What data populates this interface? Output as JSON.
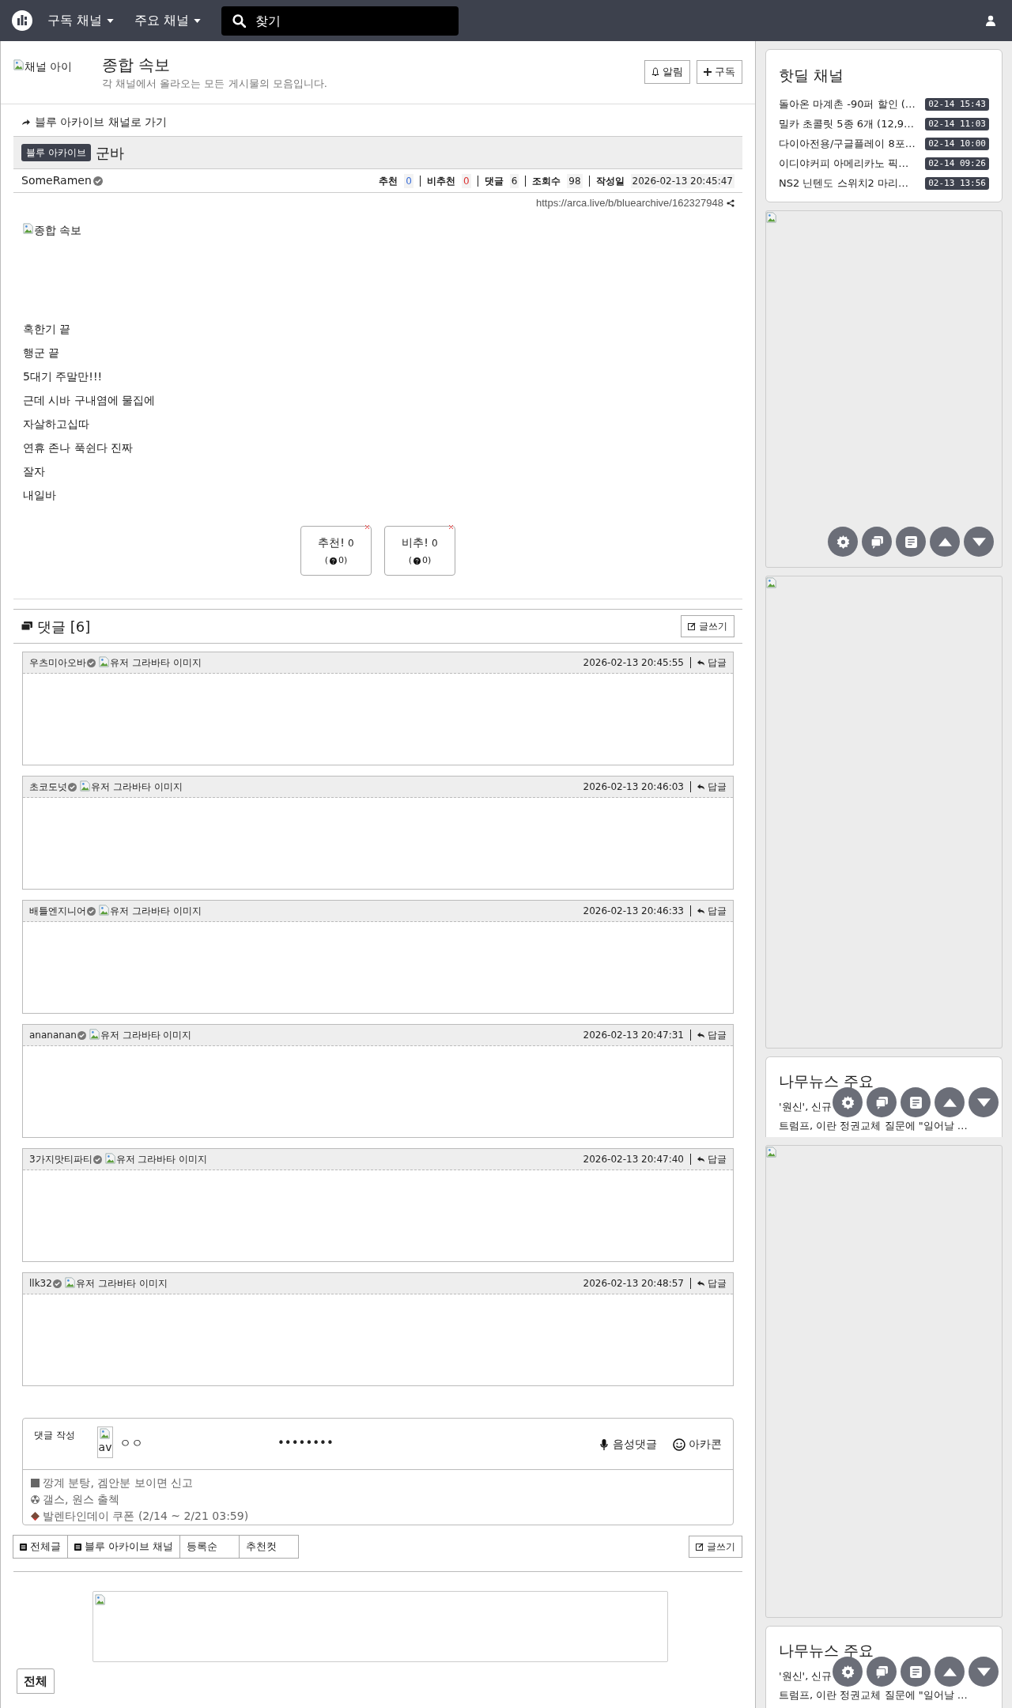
{
  "topbar": {
    "menus": [
      "구독 채널",
      "주요 채널"
    ],
    "search": {
      "placeholder": "찾기"
    }
  },
  "channel": {
    "icon_alt": "채널 아이",
    "title": "종합 속보",
    "description": "각 채널에서 올라오는 모든 게시물의 모음입니다.",
    "buttons": [
      "알림",
      "구독"
    ]
  },
  "post": {
    "back_link": "블루 아카이브 채널로 가기",
    "category": "블루 아카이브",
    "title": "군바",
    "author": "SomeRamen",
    "stats": [
      {
        "label": "추천",
        "value": "0",
        "kind": "up"
      },
      {
        "label": "비추천",
        "value": "0",
        "kind": "down"
      },
      {
        "label": "댓글",
        "value": "6",
        "kind": "plain"
      },
      {
        "label": "조회수",
        "value": "98",
        "kind": "plain"
      },
      {
        "label": "작성일",
        "value": "2026-02-13 20:45:47",
        "kind": "date"
      }
    ],
    "url": "https://arca.live/b/bluearchive/162327948",
    "image_alt": "종합 속보",
    "body": [
      "혹한기 끝",
      "행군 끝",
      "5대기 주말만!!!",
      "근데 시바 구내염에 물집에",
      "자살하고십따",
      "연휴 존나 푹쉰다 진짜",
      "잘자",
      "내일바"
    ],
    "votes": [
      {
        "label": "추천!",
        "count": "0",
        "open": "(",
        "sub": "0)"
      },
      {
        "label": "비추!",
        "count": "0",
        "open": "(",
        "sub": "0)"
      }
    ]
  },
  "comments": {
    "title": "댓글 [6]",
    "write": "글쓰기",
    "items": [
      {
        "author": "우츠미아오바",
        "avatar_alt": "유저 그라바타 이미지",
        "time": "2026-02-13 20:45:55",
        "reply": "답글"
      },
      {
        "author": "초코도넛",
        "avatar_alt": "유저 그라바타 이미지",
        "time": "2026-02-13 20:46:03",
        "reply": "답글"
      },
      {
        "author": "배틀엔지니어",
        "avatar_alt": "유저 그라바타 이미지",
        "time": "2026-02-13 20:46:33",
        "reply": "답글"
      },
      {
        "author": "anananan",
        "avatar_alt": "유저 그라바타 이미지",
        "time": "2026-02-13 20:47:31",
        "reply": "답글"
      },
      {
        "author": "3가지맛티파티",
        "avatar_alt": "유저 그라바타 이미지",
        "time": "2026-02-13 20:47:40",
        "reply": "답글"
      },
      {
        "author": "llk32",
        "avatar_alt": "유저 그라바타 이미지",
        "time": "2026-02-13 20:48:57",
        "reply": "답글"
      }
    ]
  },
  "compose": {
    "label": "댓글 작성",
    "avatar_alt": "av",
    "nickname": "ㅇㅇ",
    "password": "••••••••",
    "voice": "음성댓글",
    "emoticon": "아카콘",
    "notices": [
      {
        "kind": "square",
        "text": "깡계 분탕, 겜안분 보이면 신고"
      },
      {
        "kind": "radiation",
        "text": "갤스, 원스 출첵"
      },
      {
        "kind": "chocolate",
        "text": "발렌타인데이 쿠폰 (2/14 ~ 2/21 03:59)"
      }
    ]
  },
  "list_tabs": [
    {
      "label": "전체글",
      "kind": "icon"
    },
    {
      "label": "블루 아카이브 채널",
      "kind": "icon"
    },
    {
      "label": "등록순",
      "kind": "plain"
    },
    {
      "label": "추천컷",
      "kind": "plain"
    }
  ],
  "list_write": "글쓰기",
  "filter_button": "전체",
  "sidebar": {
    "hotdeal": {
      "title": "핫딜 채널",
      "items": [
        {
          "title": "돌아온 마계촌 -90퍼 할인 (…",
          "time": "02-14 15:43"
        },
        {
          "title": "밀카 초콜릿 5종 6개 (12,9…",
          "time": "02-14 11:03"
        },
        {
          "title": "다이아전용/구글플레이 8포…",
          "time": "02-14 10:00"
        },
        {
          "title": "이디야커피 아메리카노 픽…",
          "time": "02-14 09:26"
        },
        {
          "title": "NS2 닌텐도 스위치2 마리…",
          "time": "02-13 13:56"
        }
      ]
    },
    "news": [
      {
        "title": "나무뉴스 주요",
        "lines": [
          "'원신', 신규",
          "트럼프, 이란 정권교체 질문에 \"일어날 …"
        ]
      },
      {
        "title": "나무뉴스 주요",
        "lines": [
          "'원신', 신규",
          "트럼프, 이란 정권교체 질문에 \"일어날 …"
        ]
      }
    ]
  }
}
